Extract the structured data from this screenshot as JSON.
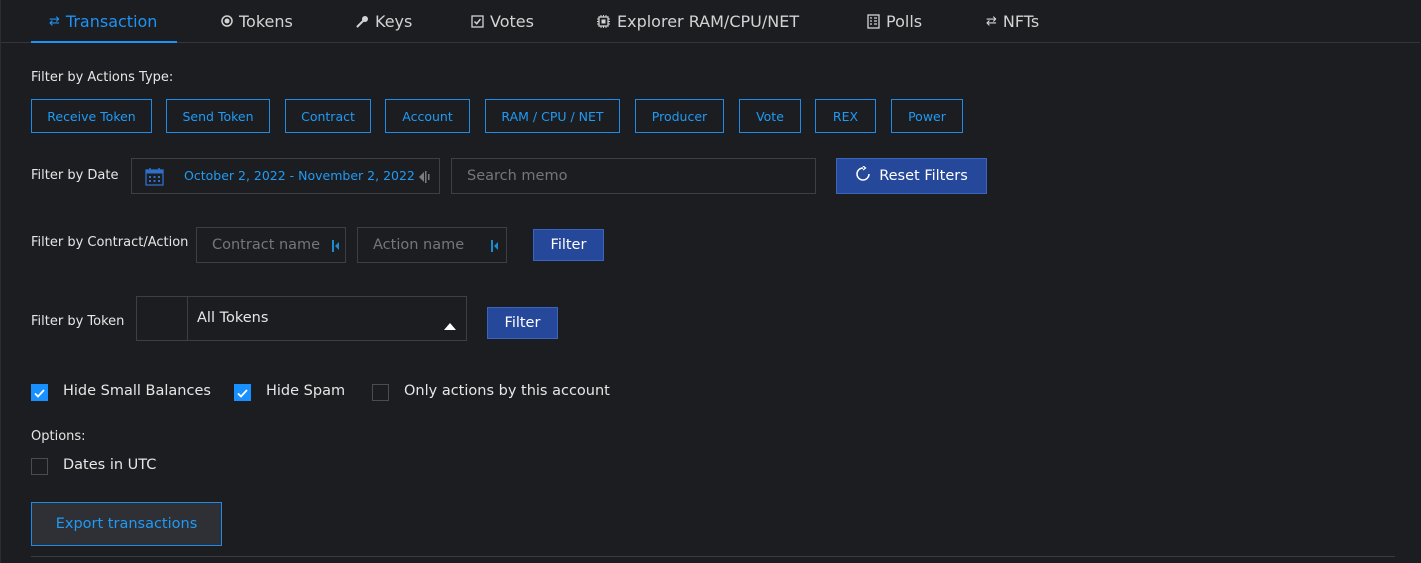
{
  "tabs": [
    {
      "label": "Transaction",
      "icon": "swap-icon",
      "active": true
    },
    {
      "label": "Tokens",
      "icon": "coin-icon"
    },
    {
      "label": "Keys",
      "icon": "key-icon"
    },
    {
      "label": "Votes",
      "icon": "ballot-check-icon"
    },
    {
      "label": "Explorer RAM/CPU/NET",
      "icon": "chip-icon"
    },
    {
      "label": "Polls",
      "icon": "poll-list-icon"
    },
    {
      "label": "NFTs",
      "icon": "swap-icon"
    }
  ],
  "filters": {
    "actions_type_label": "Filter by Actions Type:",
    "actions": [
      "Receive Token",
      "Send Token",
      "Contract",
      "Account",
      "RAM / CPU / NET",
      "Producer",
      "Vote",
      "REX",
      "Power"
    ],
    "date_label": "Filter by Date",
    "date_range": "October 2, 2022 - November 2, 2022",
    "memo_placeholder": "Search memo",
    "reset_label": "Reset Filters",
    "contract_action_label": "Filter by Contract/Action",
    "contract_placeholder": "Contract name",
    "action_placeholder": "Action name",
    "filter_button": "Filter",
    "token_label": "Filter by Token",
    "token_selected": "All Tokens",
    "token_filter_button": "Filter"
  },
  "checkboxes": [
    {
      "label": "Hide Small Balances",
      "checked": true
    },
    {
      "label": "Hide Spam",
      "checked": true
    },
    {
      "label": "Only actions by this account",
      "checked": false
    }
  ],
  "options": {
    "label": "Options:",
    "dates_utc": {
      "label": "Dates in UTC",
      "checked": false
    }
  },
  "export_label": "Export transactions",
  "colors": {
    "accent": "#1e93f5",
    "button": "#25489a",
    "background": "#1c1d20"
  }
}
